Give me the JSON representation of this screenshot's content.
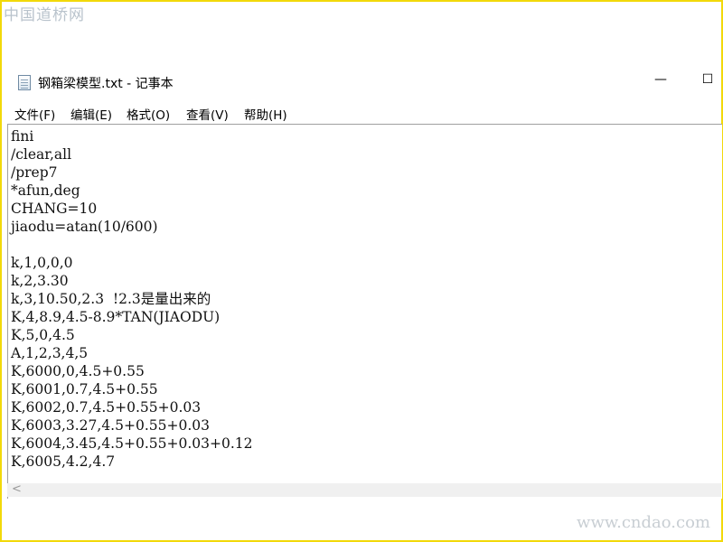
{
  "watermarks": {
    "top": "中国道桥网",
    "bottom": "www.cndao.com"
  },
  "window": {
    "title": "钢箱梁模型.txt - 记事本",
    "minimize_glyph": "—",
    "maximize_glyph": "☐"
  },
  "menu": [
    "文件(F)",
    "编辑(E)",
    "格式(O)",
    "查看(V)",
    "帮助(H)"
  ],
  "editor": {
    "lines": [
      "fini",
      "/clear,all",
      "/prep7",
      "*afun,deg",
      "CHANG=10",
      "jiaodu=atan(10/600)",
      "",
      "k,1,0,0,0",
      "k,2,3.30",
      "k,3,10.50,2.3  !2.3是量出来的",
      "K,4,8.9,4.5-8.9*TAN(JIAODU)",
      "K,5,0,4.5",
      "A,1,2,3,4,5",
      "K,6000,0,4.5+0.55",
      "K,6001,0.7,4.5+0.55",
      "K,6002,0.7,4.5+0.55+0.03",
      "K,6003,3.27,4.5+0.55+0.03",
      "K,6004,3.45,4.5+0.55+0.03+0.12",
      "K,6005,4.2,4.7"
    ]
  },
  "scrollbar": {
    "left_arrow": "<"
  },
  "colors": {
    "frame": "#f2d90a",
    "watermark": "#b9c3cc"
  }
}
